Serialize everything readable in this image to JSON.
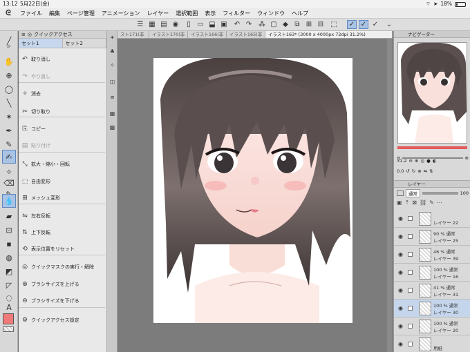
{
  "status": {
    "time": "13:12",
    "date": "5月22日(金)",
    "battery": "18%"
  },
  "menu": [
    "ファイル",
    "編集",
    "ページ管理",
    "アニメーション",
    "レイヤー",
    "選択範囲",
    "表示",
    "フィルター",
    "ウィンドウ",
    "ヘルプ"
  ],
  "quick_access": {
    "title": "クイックアクセス",
    "tabs": [
      "セット1",
      "セット2"
    ],
    "items": [
      {
        "label": "取り消し",
        "icon": "undo-icon",
        "enabled": true
      },
      {
        "label": "やり直し",
        "icon": "redo-icon",
        "enabled": false
      },
      {
        "label": "消去",
        "icon": "clear-icon",
        "enabled": true
      },
      {
        "label": "切り取り",
        "icon": "scissors-icon",
        "enabled": true
      },
      {
        "label": "コピー",
        "icon": "copy-icon",
        "enabled": true
      },
      {
        "label": "貼り付け",
        "icon": "paste-icon",
        "enabled": false
      },
      {
        "label": "拡大・縮小・回転",
        "icon": "scale-rotate-icon",
        "enabled": true
      },
      {
        "label": "自由変形",
        "icon": "free-transform-icon",
        "enabled": true
      },
      {
        "label": "メッシュ変形",
        "icon": "mesh-transform-icon",
        "enabled": true
      },
      {
        "label": "左右反転",
        "icon": "flip-horizontal-icon",
        "enabled": true
      },
      {
        "label": "上下反転",
        "icon": "flip-vertical-icon",
        "enabled": true
      },
      {
        "label": "表示位置をリセット",
        "icon": "reset-view-icon",
        "enabled": true
      },
      {
        "label": "クイックマスクの実行・解除",
        "icon": "quick-mask-icon",
        "enabled": true
      },
      {
        "label": "ブラシサイズを上げる",
        "icon": "brush-size-up-icon",
        "enabled": true
      },
      {
        "label": "ブラシサイズを下げる",
        "icon": "brush-size-down-icon",
        "enabled": true
      },
      {
        "label": "クイックアクセス設定",
        "icon": "settings-icon",
        "enabled": true
      }
    ]
  },
  "doc_tabs": [
    "スト171(非",
    "イラスト170(非",
    "イラスト166(非",
    "イラスト165(非",
    "イラスト163* (3000 x 4000px 72dpi 31.2%)"
  ],
  "navigator": {
    "title": "ナビゲーター",
    "zoom": "31.2",
    "angle": "0.0"
  },
  "layers": {
    "title": "レイヤー",
    "blend_mode": "通常",
    "opacity": "100",
    "rows": [
      {
        "line1": "",
        "line2": "レイヤー 22"
      },
      {
        "line1": "90 % 通常",
        "line2": "レイヤー 25"
      },
      {
        "line1": "46 % 通常",
        "line2": "レイヤー 39"
      },
      {
        "line1": "100 % 通常",
        "line2": "レイヤー 16"
      },
      {
        "line1": "41 % 通常",
        "line2": "レイヤー 31"
      },
      {
        "line1": "100 % 通常",
        "line2": "レイヤー 30"
      },
      {
        "line1": "100 % 通常",
        "line2": "レイヤー 20"
      },
      {
        "line1": "",
        "line2": "用紙"
      }
    ],
    "selected_index": 5
  },
  "colors": {
    "accent": "#5f87c0",
    "main_color": "#f07a7a"
  }
}
